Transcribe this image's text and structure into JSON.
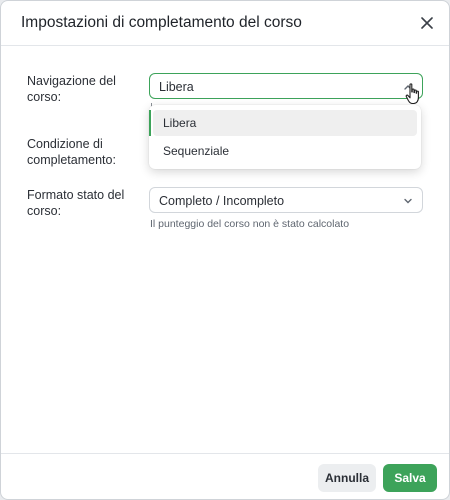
{
  "dialog": {
    "title": "Impostazioni di completamento del corso",
    "close_icon": "close-icon"
  },
  "fields": {
    "navigation": {
      "label": "Navigazione del corso:",
      "value": "Libera",
      "options": [
        "Libera",
        "Sequenziale"
      ],
      "selected_option": "Libera"
    },
    "completion_condition": {
      "label": "Condizione di completamento:"
    },
    "status_format": {
      "label": "Formato stato del corso:",
      "value": "Completo / Incompleto",
      "hint": "Il punteggio del corso non è stato calcolato"
    }
  },
  "footer": {
    "cancel_label": "Annulla",
    "save_label": "Salva"
  },
  "colors": {
    "accent": "#3da35a",
    "cancel_bg": "#eceef0"
  },
  "icons": [
    "close-icon",
    "chevron-up-icon",
    "chevron-down-icon",
    "hand-pointer-icon"
  ]
}
